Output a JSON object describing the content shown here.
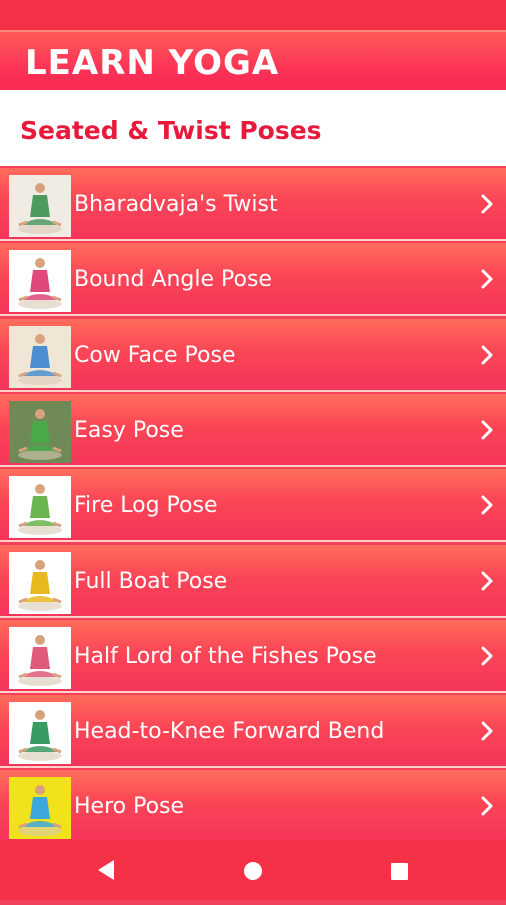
{
  "header": {
    "title": "LEARN YOGA"
  },
  "section": {
    "title": "Seated & Twist Poses"
  },
  "poses": [
    {
      "label": "Bharadvaja's Twist",
      "thumb_bg": "#f1ece3",
      "outfit": "#4e9b62"
    },
    {
      "label": "Bound Angle Pose",
      "thumb_bg": "#ffffff",
      "outfit": "#e0477a"
    },
    {
      "label": "Cow Face Pose",
      "thumb_bg": "#efe6d6",
      "outfit": "#4c8fd0"
    },
    {
      "label": "Easy Pose",
      "thumb_bg": "#6f8a56",
      "outfit": "#48a84a"
    },
    {
      "label": "Fire Log Pose",
      "thumb_bg": "#ffffff",
      "outfit": "#6ab54f"
    },
    {
      "label": "Full Boat Pose",
      "thumb_bg": "#ffffff",
      "outfit": "#e9b81f"
    },
    {
      "label": "Half Lord of the Fishes Pose",
      "thumb_bg": "#ffffff",
      "outfit": "#e05b79"
    },
    {
      "label": "Head-to-Knee Forward Bend",
      "thumb_bg": "#ffffff",
      "outfit": "#3a9a63"
    },
    {
      "label": "Hero Pose",
      "thumb_bg": "#f1e21c",
      "outfit": "#3ba7dc"
    }
  ],
  "icons": {
    "row_action": "chevron-right-icon",
    "nav_back": "back-triangle-icon",
    "nav_home": "home-circle-icon",
    "nav_recents": "recents-square-icon"
  },
  "colors": {
    "accent": "#e8193b",
    "header": "#fb3055",
    "row": "#fb4656"
  }
}
